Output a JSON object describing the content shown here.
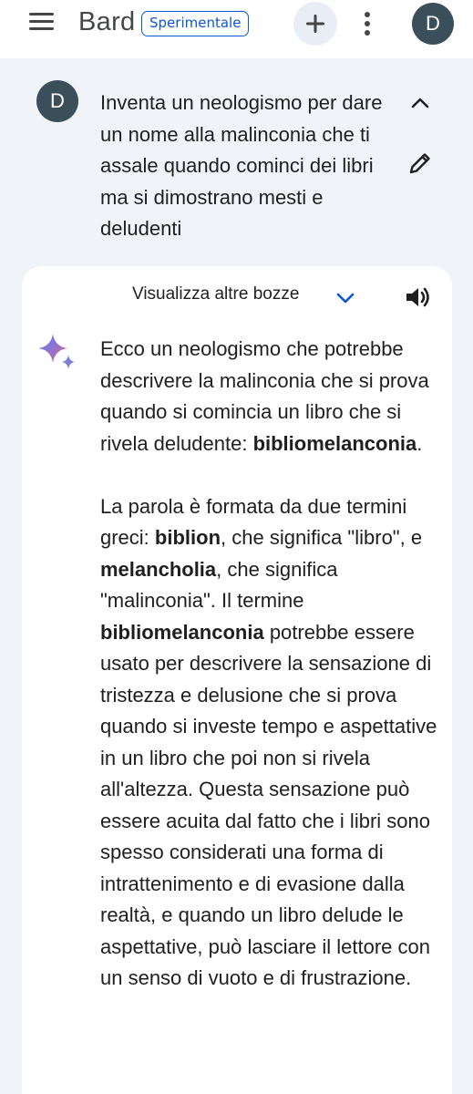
{
  "topbar": {
    "brand": "Bard",
    "badge": "Sperimentale",
    "avatar_initial": "D"
  },
  "prompt": {
    "avatar_initial": "D",
    "text": "Inventa un neologismo per dare un nome alla malinconia che ti assale quando cominci dei libri ma si dimostrano mesti e deludenti"
  },
  "response": {
    "drafts_label": "Visualizza altre bozze",
    "p1_a": "Ecco un neologismo che potrebbe descrivere la malinconia che si prova quando si comincia un libro che si rivela deludente: ",
    "p1_b": "bibliomelanconia",
    "p1_c": ".",
    "p2_a": "La parola è formata da due termini greci: ",
    "p2_b": "biblion",
    "p2_c": ", che significa \"libro\", e ",
    "p2_d": "melancholia",
    "p2_e": ", che significa \"malinconia\". Il termine ",
    "p2_f": "bibliomelanconia",
    "p2_g": " potrebbe essere usato per descrivere la sensazione di tristezza e delusione che si prova quando si investe tempo e aspettative in un libro che poi non si rivela all'altezza. Questa sensazione può essere acuita dal fatto che i libri sono spesso considerati una forma di intrattenimento e di evasione dalla realtà, e quando un libro delude le aspettative, può lasciare il lettore con un senso di vuoto e di frustrazione."
  },
  "colors": {
    "background": "#f0f4f9",
    "accent": "#0b57d0",
    "avatar": "#3b4f5a"
  },
  "icons": [
    "menu-icon",
    "plus-icon",
    "more-vert-icon",
    "chevron-up-icon",
    "edit-icon",
    "chevron-down-icon",
    "speaker-icon",
    "sparkle-icon"
  ]
}
